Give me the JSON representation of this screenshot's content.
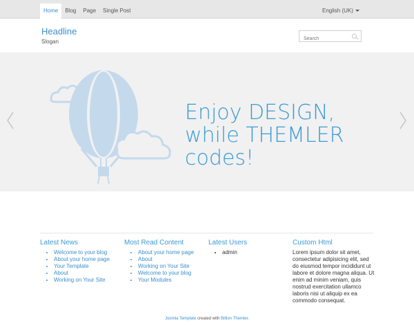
{
  "nav": {
    "items": [
      {
        "label": "Home",
        "active": true
      },
      {
        "label": "Blog",
        "active": false
      },
      {
        "label": "Page",
        "active": false
      },
      {
        "label": "Single Post",
        "active": false
      }
    ],
    "language": "English (UK)"
  },
  "header": {
    "headline": "Headline",
    "slogan": "Slogan",
    "search_placeholder": "Search"
  },
  "slider": {
    "text_line1": "Enjoy DESIGN,",
    "text_line2": "while THEMLER",
    "text_line3": "codes!"
  },
  "widgets": {
    "latest_news": {
      "title": "Latest News",
      "items": [
        "Welcome to your blog",
        "About your home page",
        "Your Template",
        "About",
        "Working on Your Site"
      ]
    },
    "most_read": {
      "title": "Most Read Content",
      "items": [
        "About your home page",
        "About",
        "Working on Your Site",
        "Welcome to your blog",
        "Your Modules"
      ]
    },
    "latest_users": {
      "title": "Latest Users",
      "items": [
        "admin"
      ]
    },
    "custom_html": {
      "title": "Custom Html",
      "text": "Lorem ipsum dolor sit amet, consectetur adipisicing elit, sed do eiusmod tempor incididunt ut labore et dolore magna aliqua. Ut enim ad minim veniam, quis nostrud exercitation ullamco laboris nisi ut aliquip ex ea commodo consequat."
    }
  },
  "footer": {
    "link1": "Joomla Template",
    "middle": " created with ",
    "link2": "Billion Themler",
    "end": "."
  },
  "colors": {
    "accent": "#3a8fcc",
    "slider_bg": "#f1f1f1",
    "balloon": "#c4d9ec"
  }
}
